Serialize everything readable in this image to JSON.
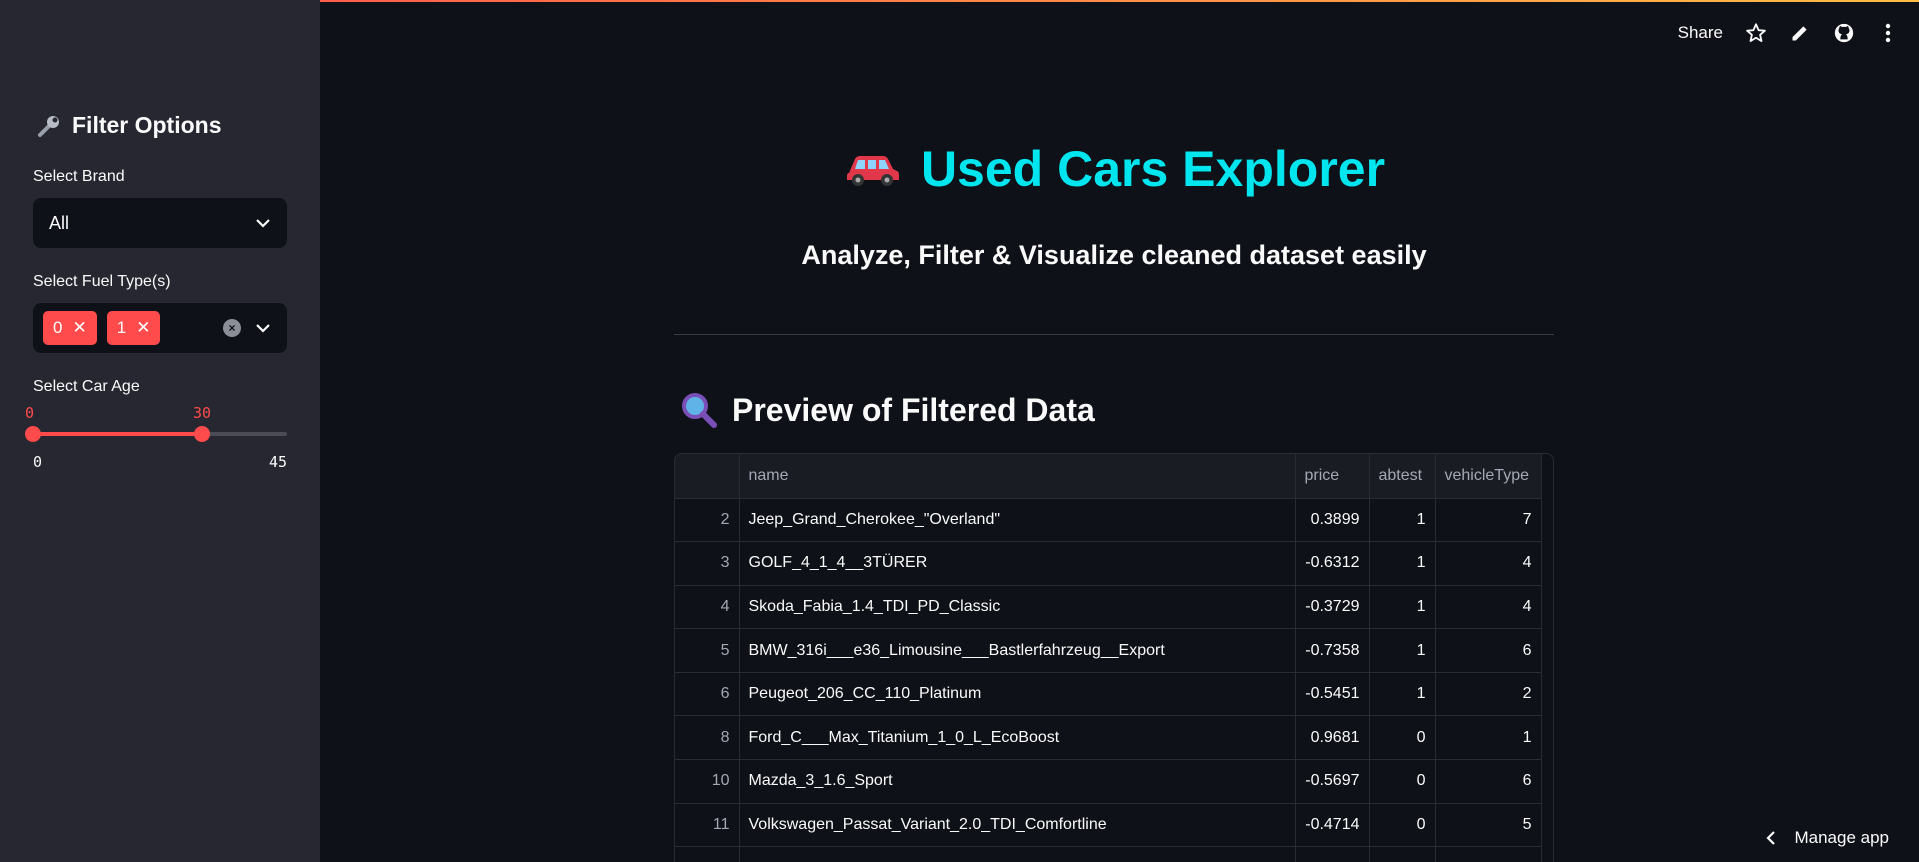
{
  "sidebar": {
    "title": "Filter Options",
    "brand": {
      "label": "Select Brand",
      "value": "All"
    },
    "fuel": {
      "label": "Select Fuel Type(s)",
      "tags": [
        "0",
        "1"
      ]
    },
    "age": {
      "label": "Select Car Age",
      "min_sel": "0",
      "max_sel": "30",
      "min": "0",
      "max": "45",
      "range": [
        0,
        30
      ],
      "bounds": [
        0,
        45
      ]
    }
  },
  "toolbar": {
    "share_label": "Share"
  },
  "hero": {
    "title": "Used Cars Explorer",
    "subtitle": "Analyze, Filter & Visualize cleaned dataset easily"
  },
  "section": {
    "title": "Preview of Filtered Data"
  },
  "table": {
    "columns": [
      "",
      "name",
      "price",
      "abtest",
      "vehicleType"
    ],
    "rows": [
      [
        "2",
        "Jeep_Grand_Cherokee_\"Overland\"",
        "0.3899",
        "1",
        "7"
      ],
      [
        "3",
        "GOLF_4_1_4__3TÜRER",
        "-0.6312",
        "1",
        "4"
      ],
      [
        "4",
        "Skoda_Fabia_1.4_TDI_PD_Classic",
        "-0.3729",
        "1",
        "4"
      ],
      [
        "5",
        "BMW_316i___e36_Limousine___Bastlerfahrzeug__Export",
        "-0.7358",
        "1",
        "6"
      ],
      [
        "6",
        "Peugeot_206_CC_110_Platinum",
        "-0.5451",
        "1",
        "2"
      ],
      [
        "8",
        "Ford_C___Max_Titanium_1_0_L_EcoBoost",
        "0.9681",
        "0",
        "1"
      ],
      [
        "10",
        "Mazda_3_1.6_Sport",
        "-0.5697",
        "0",
        "6"
      ],
      [
        "11",
        "Volkswagen_Passat_Variant_2.0_TDI_Comfortline",
        "-0.4714",
        "0",
        "5"
      ],
      [
        "",
        "",
        "",
        "",
        ""
      ]
    ]
  },
  "footer": {
    "manage_label": "Manage app"
  },
  "colors": {
    "accent": "#ff4b4b",
    "title": "#00e5ee",
    "background": "#0e1117",
    "sidebar": "#262730"
  }
}
